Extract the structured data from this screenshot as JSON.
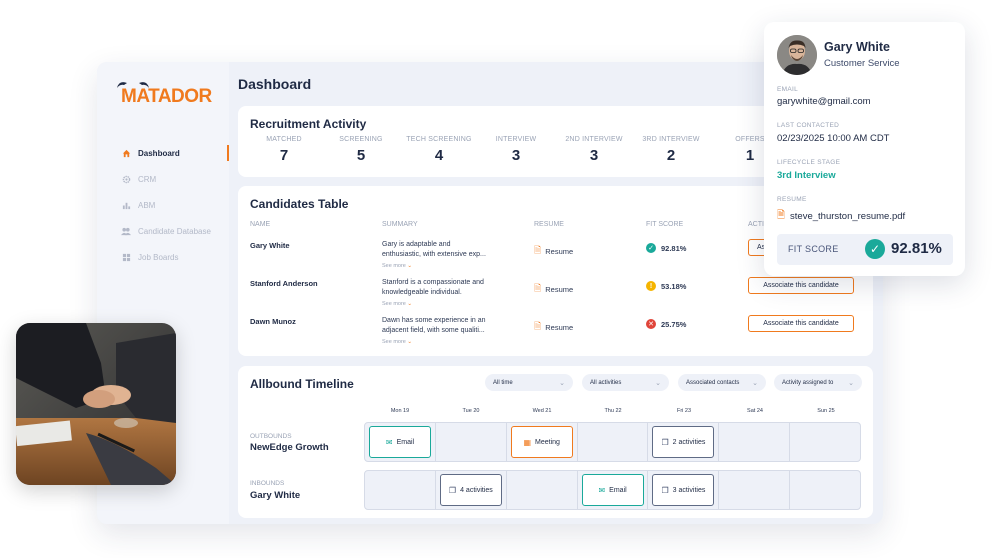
{
  "brand": {
    "logo_text": "MATADOR",
    "accent": "#f07a1e",
    "teal": "#1aa99a",
    "navy": "#1f2a44"
  },
  "sidebar": {
    "items": [
      {
        "label": "Dashboard",
        "icon": "home-icon",
        "active": true
      },
      {
        "label": "CRM",
        "icon": "gear-icon",
        "active": false
      },
      {
        "label": "ABM",
        "icon": "bar-chart-icon",
        "active": false
      },
      {
        "label": "Candidate Database",
        "icon": "users-icon",
        "active": false
      },
      {
        "label": "Job Boards",
        "icon": "grid-icon",
        "active": false
      }
    ]
  },
  "header": {
    "title": "Dashboard"
  },
  "recruitment": {
    "title": "Recruitment Activity",
    "stats": [
      {
        "label": "MATCHED",
        "value": "7"
      },
      {
        "label": "SCREENING",
        "value": "5"
      },
      {
        "label": "TECH SCREENING",
        "value": "4"
      },
      {
        "label": "INTERVIEW",
        "value": "3"
      },
      {
        "label": "2ND INTERVIEW",
        "value": "3"
      },
      {
        "label": "3RD INTERVIEW",
        "value": "2"
      },
      {
        "label": "OFFERS",
        "value": "1"
      }
    ]
  },
  "candidates": {
    "title": "Candidates Table",
    "columns": [
      "NAME",
      "SUMMARY",
      "RESUME",
      "FIT SCORE",
      "ACTI"
    ],
    "see_more": "See more",
    "resume_label": "Resume",
    "rows": [
      {
        "name": "Gary White",
        "summary_1": "Gary is adaptable and",
        "summary_2": "enthusiastic, with extensive exp...",
        "fit": "92.81%",
        "fit_status": "good",
        "action": "Asso"
      },
      {
        "name": "Stanford Anderson",
        "summary_1": "Stanford is a compassionate and",
        "summary_2": "knowledgeable individual.",
        "fit": "53.18%",
        "fit_status": "warn",
        "action": "Associate this candidate"
      },
      {
        "name": "Dawn Munoz",
        "summary_1": "Dawn has some experience in an",
        "summary_2": "adjacent field, with some qualiti...",
        "fit": "25.75%",
        "fit_status": "bad",
        "action": "Associate this candidate"
      }
    ]
  },
  "timeline": {
    "title": "Allbound Timeline",
    "filters": [
      "All time",
      "All activities",
      "Associated contacts",
      "Activity assigned to"
    ],
    "days": [
      "Mon 19",
      "Tue 20",
      "Wed 21",
      "Thu 22",
      "Fri 23",
      "Sat 24",
      "Sun 25"
    ],
    "lanes": [
      {
        "label": "OUTBOUNDS",
        "name": "NewEdge Growth"
      },
      {
        "label": "INBOUNDS",
        "name": "Gary White"
      }
    ],
    "events": {
      "out_mon": "Email",
      "out_wed": "Meeting",
      "out_fri": "2 activities",
      "in_tue": "4 activities",
      "in_thu": "Email",
      "in_fri": "3 activities"
    }
  },
  "profile": {
    "name": "Gary White",
    "role": "Customer Service",
    "email_label": "EMAIL",
    "email": "garywhite@gmail.com",
    "contacted_label": "LAST CONTACTED",
    "contacted": "02/23/2025 10:00 AM CDT",
    "stage_label": "LIFECYCLE STAGE",
    "stage": "3rd Interview",
    "resume_label": "RESUME",
    "resume_file": "steve_thurston_resume.pdf",
    "fit_label": "FIT SCORE",
    "fit_value": "92.81%"
  }
}
